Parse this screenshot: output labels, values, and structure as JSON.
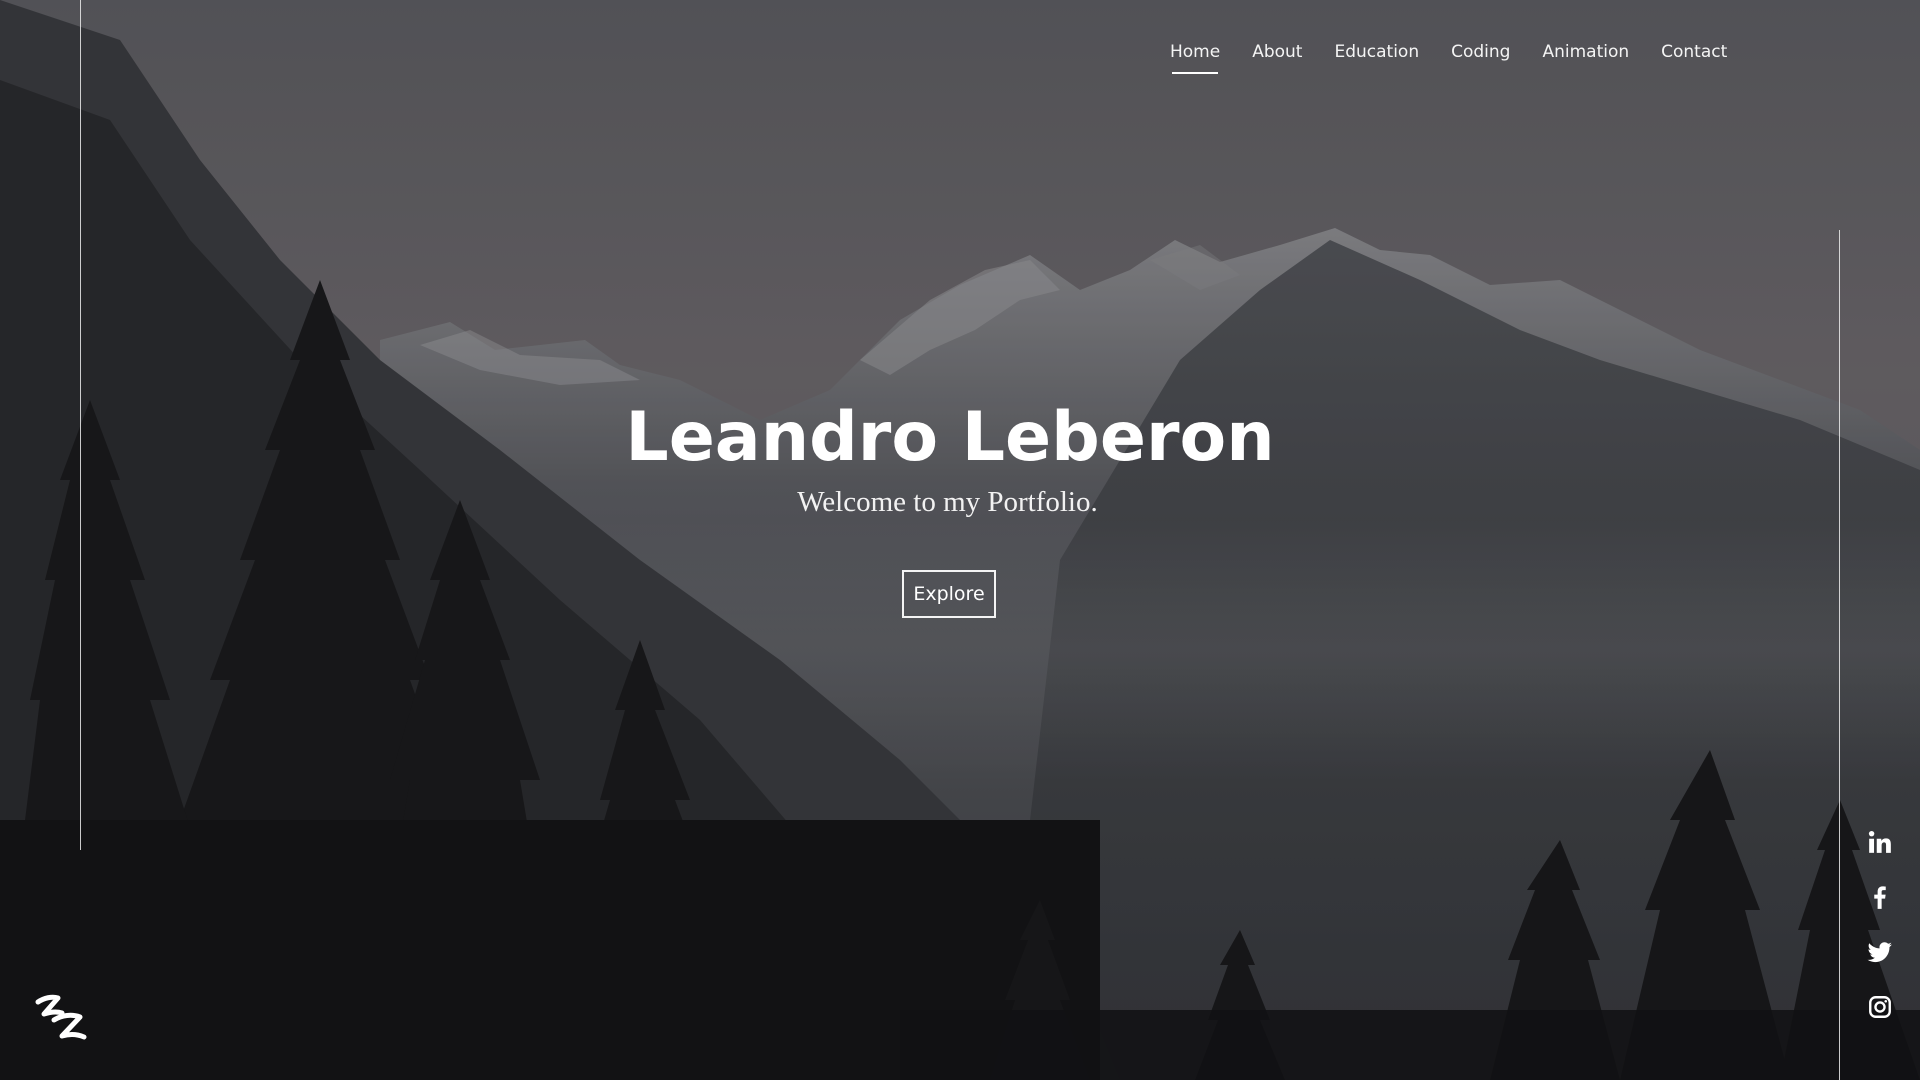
{
  "nav": {
    "items": [
      {
        "label": "Home",
        "active": true
      },
      {
        "label": "About",
        "active": false
      },
      {
        "label": "Education",
        "active": false
      },
      {
        "label": "Coding",
        "active": false
      },
      {
        "label": "Animation",
        "active": false
      },
      {
        "label": "Contact",
        "active": false
      }
    ]
  },
  "hero": {
    "title": "Leandro Leberon",
    "subtitle": "Welcome to my Portfolio.",
    "button_label": "Explore"
  },
  "social": {
    "icons": [
      "linkedin-icon",
      "facebook-icon",
      "twitter-icon",
      "instagram-icon"
    ]
  },
  "logo": {
    "icon": "zz-logo-icon"
  },
  "colors": {
    "text": "#ffffff",
    "background_dark": "#1b1b1e",
    "background_sky": "#6a686d"
  }
}
